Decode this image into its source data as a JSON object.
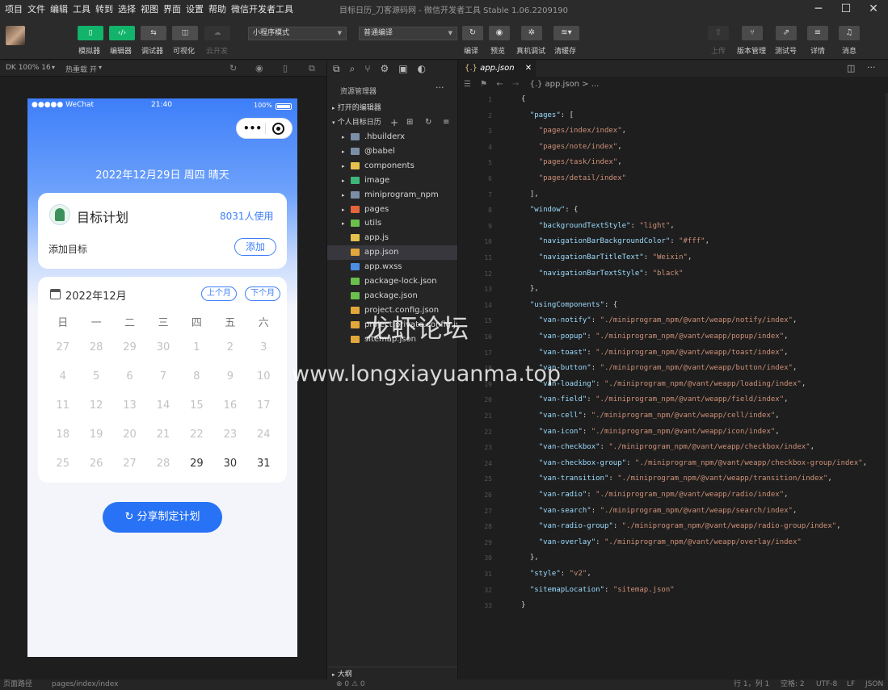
{
  "menu": [
    "项目",
    "文件",
    "编辑",
    "工具",
    "转到",
    "选择",
    "视图",
    "界面",
    "设置",
    "帮助",
    "微信开发者工具"
  ],
  "window_title": "目标日历_刀客源码网 - 微信开发者工具 Stable 1.06.2209190",
  "toolbar": {
    "left_buttons": [
      "模拟器",
      "编辑器",
      "调试器",
      "可视化",
      "云开发"
    ],
    "mode_select": "小程序模式",
    "compile_select": "普通编译",
    "mid_buttons": [
      "编译",
      "预览",
      "真机调试",
      "清缓存"
    ],
    "right_buttons": [
      "上传",
      "版本管理",
      "测试号",
      "详情",
      "消息"
    ]
  },
  "simulator_bar": {
    "zoom": "DK 100% 16",
    "hot_reload": "热重载 开"
  },
  "phone": {
    "status_left": "●●●●● WeChat",
    "status_time": "21:40",
    "status_battery": "100%",
    "date_line": "2022年12月29日 周四 晴天",
    "plan_card": {
      "title": "目标计划",
      "users": "8031人使用",
      "add_label": "添加目标",
      "add_button": "添加"
    },
    "calendar": {
      "month": "2022年12月",
      "prev": "上个月",
      "next": "下个月",
      "weekdays": [
        "日",
        "一",
        "二",
        "三",
        "四",
        "五",
        "六"
      ],
      "weeks": [
        [
          "27",
          "28",
          "29",
          "30",
          "1",
          "2",
          "3"
        ],
        [
          "4",
          "5",
          "6",
          "7",
          "8",
          "9",
          "10"
        ],
        [
          "11",
          "12",
          "13",
          "14",
          "15",
          "16",
          "17"
        ],
        [
          "18",
          "19",
          "20",
          "21",
          "22",
          "23",
          "24"
        ],
        [
          "25",
          "26",
          "27",
          "28",
          "29",
          "30",
          "31"
        ]
      ]
    },
    "share_button": "分享制定计划"
  },
  "explorer": {
    "title": "资源管理器",
    "open_editors": "打开的编辑器",
    "project": "个人目标日历",
    "items": [
      {
        "name": ".hbuilderx",
        "kind": "folder"
      },
      {
        "name": "@babel",
        "kind": "folder"
      },
      {
        "name": "components",
        "kind": "folder"
      },
      {
        "name": "image",
        "kind": "folder"
      },
      {
        "name": "miniprogram_npm",
        "kind": "folder"
      },
      {
        "name": "pages",
        "kind": "folder"
      },
      {
        "name": "utils",
        "kind": "folder"
      },
      {
        "name": "app.js",
        "kind": "js"
      },
      {
        "name": "app.json",
        "kind": "json"
      },
      {
        "name": "app.wxss",
        "kind": "wxss"
      },
      {
        "name": "package-lock.json",
        "kind": "npm"
      },
      {
        "name": "package.json",
        "kind": "npm"
      },
      {
        "name": "project.config.json",
        "kind": "json"
      },
      {
        "name": "project.private.config.js...",
        "kind": "json"
      },
      {
        "name": "sitemap.json",
        "kind": "json"
      }
    ],
    "outline": "大纲"
  },
  "editor": {
    "tab": "app.json",
    "breadcrumb": "{.} app.json > ...",
    "lines": [
      "{",
      "  \"pages\": [",
      "    \"pages/index/index\",",
      "    \"pages/note/index\",",
      "    \"pages/task/index\",",
      "    \"pages/detail/index\"",
      "  ],",
      "  \"window\": {",
      "    \"backgroundTextStyle\": \"light\",",
      "    \"navigationBarBackgroundColor\": \"#fff\",",
      "    \"navigationBarTitleText\": \"Weixin\",",
      "    \"navigationBarTextStyle\": \"black\"",
      "  },",
      "  \"usingComponents\": {",
      "    \"van-notify\": \"./miniprogram_npm/@vant/weapp/notify/index\",",
      "    \"van-popup\": \"./miniprogram_npm/@vant/weapp/popup/index\",",
      "    \"van-toast\": \"./miniprogram_npm/@vant/weapp/toast/index\",",
      "    \"van-button\": \"./miniprogram_npm/@vant/weapp/button/index\",",
      "    \"van-loading\": \"./miniprogram_npm/@vant/weapp/loading/index\",",
      "    \"van-field\": \"./miniprogram_npm/@vant/weapp/field/index\",",
      "    \"van-cell\": \"./miniprogram_npm/@vant/weapp/cell/index\",",
      "    \"van-icon\": \"./miniprogram_npm/@vant/weapp/icon/index\",",
      "    \"van-checkbox\": \"./miniprogram_npm/@vant/weapp/checkbox/index\",",
      "    \"van-checkbox-group\": \"./miniprogram_npm/@vant/weapp/checkbox-group/index\",",
      "    \"van-transition\": \"./miniprogram_npm/@vant/weapp/transition/index\",",
      "    \"van-radio\": \"./miniprogram_npm/@vant/weapp/radio/index\",",
      "    \"van-search\": \"./miniprogram_npm/@vant/weapp/search/index\",",
      "    \"van-radio-group\": \"./miniprogram_npm/@vant/weapp/radio-group/index\",",
      "    \"van-overlay\": \"./miniprogram_npm/@vant/weapp/overlay/index\"",
      "  },",
      "  \"style\": \"v2\",",
      "  \"sitemapLocation\": \"sitemap.json\"",
      "}"
    ]
  },
  "status": {
    "path_label": "页面路径",
    "path": "pages/index/index",
    "problems": "⊗ 0 ⚠ 0",
    "position": "行 1，列 1",
    "spaces": "空格: 2",
    "encoding": "UTF-8",
    "eol": "LF",
    "lang": "JSON"
  },
  "watermark": {
    "line1": "龙虾论坛",
    "line2": "www.longxiayuanma.top"
  },
  "colors": {
    "accent_green": "#12b36a",
    "phone_blue": "#3d7ef9",
    "editor_bg": "#1e1e1e"
  }
}
